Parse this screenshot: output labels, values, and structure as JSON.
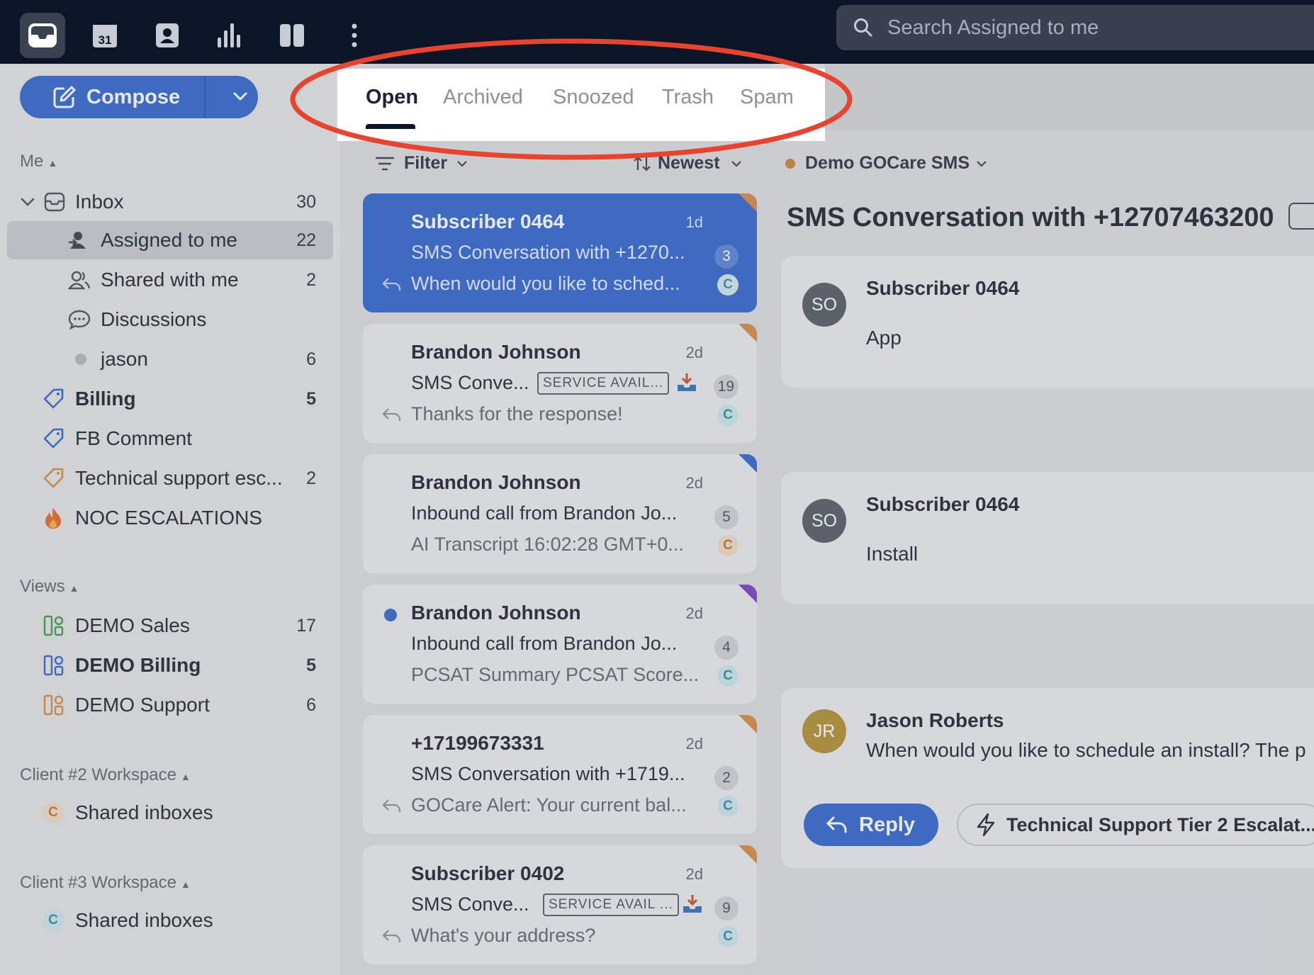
{
  "topbar": {
    "icons": [
      "inbox-icon",
      "calendar-icon",
      "contacts-icon",
      "analytics-icon",
      "split-view-icon",
      "more-icon"
    ],
    "calendar_day": "31",
    "search_placeholder": "Search Assigned to me"
  },
  "sidebar": {
    "compose_label": "Compose",
    "me_header": "Me",
    "items": [
      {
        "label": "Inbox",
        "count": "30"
      },
      {
        "label": "Assigned to me",
        "count": "22"
      },
      {
        "label": "Shared with me",
        "count": "2"
      },
      {
        "label": "Discussions",
        "count": ""
      },
      {
        "label": "jason",
        "count": "6"
      },
      {
        "label": "Billing",
        "count": "5"
      },
      {
        "label": "FB Comment",
        "count": ""
      },
      {
        "label": "Technical support esc...",
        "count": "2"
      },
      {
        "label": "NOC ESCALATIONS",
        "count": ""
      }
    ],
    "views_header": "Views",
    "views": [
      {
        "label": "DEMO Sales",
        "count": "17"
      },
      {
        "label": "DEMO Billing",
        "count": "5"
      },
      {
        "label": "DEMO Support",
        "count": "6"
      }
    ],
    "workspace2_header": "Client #2 Workspace",
    "workspace2_item": "Shared inboxes",
    "workspace2_avatar": "C",
    "workspace3_header": "Client #3 Workspace",
    "workspace3_item": "Shared inboxes",
    "workspace3_avatar": "C"
  },
  "tabs": [
    "Open",
    "Archived",
    "Snoozed",
    "Trash",
    "Spam"
  ],
  "list": {
    "filter_label": "Filter",
    "sort_label": "Newest",
    "conversations": [
      {
        "name": "Subscriber 0464",
        "time": "1d",
        "subject": "SMS Conversation with +1270...",
        "preview": "When would you like to sched...",
        "count": "3",
        "avatar": "C"
      },
      {
        "name": "Brandon Johnson",
        "time": "2d",
        "subject": "SMS Conve...",
        "tag": "SERVICE AVAIL...",
        "preview": "Thanks for the response!",
        "count": "19",
        "avatar": "C"
      },
      {
        "name": "Brandon Johnson",
        "time": "2d",
        "subject": "Inbound call from Brandon Jo...",
        "preview": "AI Transcript 16:02:28 GMT+0...",
        "count": "5",
        "avatar": "C"
      },
      {
        "name": "Brandon Johnson",
        "time": "2d",
        "subject": "Inbound call from Brandon Jo...",
        "preview": "PCSAT Summary PCSAT Score...",
        "count": "4",
        "avatar": "C"
      },
      {
        "name": "+17199673331",
        "time": "2d",
        "subject": "SMS Conversation with +1719...",
        "preview": "GOCare Alert: Your current bal...",
        "count": "2",
        "avatar": "C"
      },
      {
        "name": "Subscriber 0402",
        "time": "2d",
        "subject": "SMS Conve...",
        "tag": "SERVICE AVAIL ...",
        "preview": "What's your address?",
        "count": "9",
        "avatar": "C"
      }
    ]
  },
  "detail": {
    "inbox_name": "Demo GOCare SMS",
    "title": "SMS Conversation with +12707463200",
    "messages": [
      {
        "initials": "SO",
        "sender": "Subscriber 0464",
        "body": "App"
      },
      {
        "initials": "SO",
        "sender": "Subscriber 0464",
        "body": "Install"
      },
      {
        "initials": "JR",
        "sender": "Jason Roberts",
        "body": "When would you like to schedule an install? The p"
      }
    ],
    "reply_label": "Reply",
    "macro_label": "Technical Support Tier 2 Escalat..."
  },
  "colors": {
    "topbar": "#0c1527",
    "accent": "#3266d0",
    "annotation": "#e8432e"
  }
}
